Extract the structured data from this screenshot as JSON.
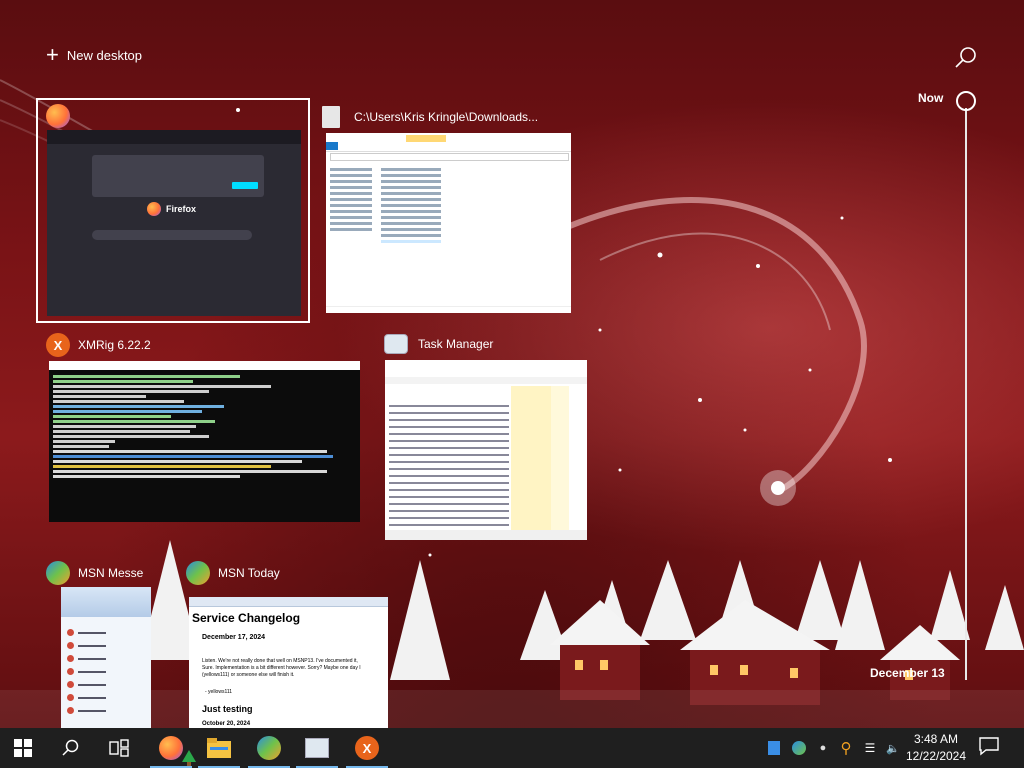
{
  "taskview": {
    "new_desktop_label": "New desktop",
    "search_icon": "search-icon",
    "timeline_now": "Now",
    "timeline_date": "December 13"
  },
  "windows": {
    "firefox": {
      "title": "",
      "brand": "Firefox",
      "icon": "firefox-icon",
      "selected": true
    },
    "explorer": {
      "title": "C:\\Users\\Kris Kringle\\Downloads...",
      "icon": "folder-icon"
    },
    "xmrig": {
      "title": "XMRig 6.22.2",
      "icon": "xmrig-icon"
    },
    "taskmanager": {
      "title": "Task Manager",
      "icon": "task-manager-icon"
    },
    "msn_messenger": {
      "title": "MSN Messe",
      "icon": "msn-messenger-icon"
    },
    "msn_today": {
      "title": "MSN Today",
      "icon": "msn-messenger-icon",
      "heading": "Service Changelog",
      "entry1_date": "December 17, 2024",
      "entry1_text": "Listen. We're not really done that well on MSNP13. I've documented it, Sure. Implementation is a bit different however. Sorry? Maybe one day I (yellows111) or someone else will finish it.",
      "entry1_code": "- yellows111",
      "entry2_title": "Just testing",
      "entry2_date": "October 20, 2024"
    }
  },
  "taskbar": {
    "start_icon": "windows-start-icon",
    "search_icon": "search-icon",
    "taskview_icon": "task-view-icon",
    "apps": [
      "firefox-icon",
      "file-explorer-icon",
      "msn-messenger-icon",
      "task-manager-icon",
      "xmrig-icon"
    ],
    "tray_icons": [
      "battery-icon",
      "msn-tray-icon",
      "drop-icon",
      "search-tool-icon",
      "wifi-icon",
      "network-icon",
      "volume-muted-icon"
    ],
    "time": "3:48 AM",
    "date": "12/22/2024",
    "notification_icon": "notification-icon"
  },
  "colors": {
    "wallpaper_red": "#8c1a1c",
    "taskbar": "#1f1f1f",
    "accent": "#76b9ed",
    "firefox_orange": "#ff7139",
    "xmrig_orange": "#e8641b"
  }
}
